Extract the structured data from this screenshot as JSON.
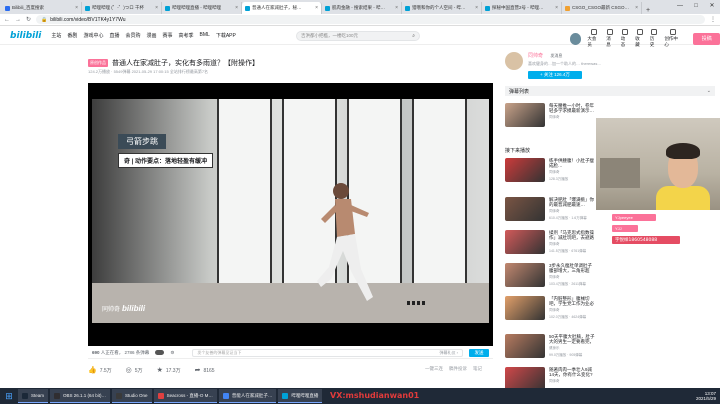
{
  "browser": {
    "tabs": [
      {
        "label": "Bilibili_百度搜索",
        "color": "#2a6cf0",
        "active": false
      },
      {
        "label": "哔哩哔哩 (゜-゜)つロ 干杯",
        "color": "#00a1d6",
        "active": false
      },
      {
        "label": "哔哩哔哩直播 - 哔哩哔哩",
        "color": "#00a1d6",
        "active": false
      },
      {
        "label": "普通人在家减肚子，秘…",
        "color": "#00a1d6",
        "active": true
      },
      {
        "label": "肌肉金融 - 搜索结果 - 哔…",
        "color": "#00a1d6",
        "active": false
      },
      {
        "label": "猎哦和你的个人空间 - 哔…",
        "color": "#00a1d6",
        "active": false
      },
      {
        "label": "探秘中国直营2号 - 哔哩…",
        "color": "#00a1d6",
        "active": false
      },
      {
        "label": "CSGO_CSGO最新 CSGO…",
        "color": "#f0a030",
        "active": false
      }
    ],
    "url": "bilibili.com/video/BV1TK4y1Y7Wu",
    "window_controls": [
      "—",
      "□",
      "✕"
    ]
  },
  "header": {
    "logo": "bilibili",
    "nav": [
      "主站",
      "番剧",
      "游戏中心",
      "直播",
      "会员购",
      "漫画",
      "赛事",
      "高考季",
      "BML",
      "下载APP"
    ],
    "search_placeholder": "吉洪都小把槛，一楼吃100元",
    "right_items": [
      "大会员",
      "消息",
      "动态",
      "收藏",
      "历史",
      "创作中心"
    ],
    "upload_label": "投稿"
  },
  "video": {
    "badge": "原创作品",
    "title": "普通人在家减肚子，实化有多雨道？【附操作】",
    "meta": "124.2万播放 · 5549弹幕    2021-05-29 17:00:15  全站排行榜最高第7名",
    "caption_main": "弓箭步跳",
    "caption_sub": "奇 | 动作要点：落地轻盈有缓冲",
    "watermark_name": "同帅奇",
    "watermark_logo": "bilibili",
    "danmaku_stats_count": "690",
    "danmaku_stats_text": "人正在看，",
    "danmaku_stats_dm": "2786 条弹幕",
    "danmaku_input_placeholder": "发个友善的弹幕见证当下",
    "danmaku_etiquette": "弹幕礼仪 ›",
    "danmaku_send": "发送",
    "actions": [
      {
        "icon": "like-icon",
        "glyph": "👍",
        "label": "7.5万"
      },
      {
        "icon": "coin-icon",
        "glyph": "◎",
        "label": "5万"
      },
      {
        "icon": "star-icon",
        "glyph": "★",
        "label": "17.3万"
      },
      {
        "icon": "share-icon",
        "glyph": "➦",
        "label": "8165"
      }
    ],
    "right_actions": [
      "一键三连",
      "稿件投诉",
      "笔记"
    ]
  },
  "uploader": {
    "name": "同帅奇",
    "message_label": "发消息",
    "desc": "喜欢健身的…加一个助人的… therewas…",
    "follow_label": "+ 关注 126.4万"
  },
  "sidebar": {
    "danmaku_list_label": "弹幕列表",
    "next_label": "接下来播放",
    "autoplay_label": "自动连播",
    "recommendations": [
      {
        "title": "每天腰推一小时，卷年轻多学求摸最新演示…",
        "author": "同帅奇",
        "stats": "",
        "color": "#c9a38a"
      },
      {
        "title": "练手供腰腹！小肚子瘦成脸…",
        "author": "同帅奇",
        "stats": "128.3万播放",
        "color": "#cc3b3b"
      },
      {
        "title": "解决肥肚「爆满挑」你的最晋减肥最速…",
        "author": "同帅奇",
        "stats": "610.4万播放 · 1.6万弹幕",
        "color": "#7a5544"
      },
      {
        "title": "揉剂「马克思式指数操作」减肚玩吧，去避路达关，让诺…",
        "author": "同帅奇",
        "stats": "141.5万播放 · 6761弹幕",
        "color": "#d25a5a"
      },
      {
        "title": "3步永久瘦肚单调肚子腹部增大，三角形超绝！",
        "author": "同帅奇",
        "stats": "103.4万播放 · 2611弹幕",
        "color": "#c28870"
      },
      {
        "title": "「内脏整形」腹械切吧，学生党工作为业必备 快速…",
        "author": "同帅奇",
        "stats": "102.0万播放 · 4624弹幕",
        "color": "#e2a06a"
      },
      {
        "title": "50天平腹大肚腩，肚子大的男生一定要看完，带着…",
        "author": "健身乐",
        "stats": "99.0万播放 · 905弹幕",
        "color": "#b77b60"
      },
      {
        "title": "随著肉肉一季壮人9减14天，你有什么变化?",
        "author": "同帅奇",
        "stats": "",
        "color": "#d1484a"
      }
    ]
  },
  "overlay": {
    "tag1": "YJpeeyee",
    "tag2": "YJJ",
    "tag3": "字悦样1860548088",
    "taskbar_overlay": "VX:mshudianwan01"
  },
  "taskbar": {
    "items": [
      {
        "label": "Steam",
        "color": "#1b2838"
      },
      {
        "label": "OBS 26.1.1 (64 bit)…",
        "color": "#302e31"
      },
      {
        "label": "Studio One",
        "color": "#3a3a3a"
      },
      {
        "label": "Seacross - 直播-O M…",
        "color": "#e04040"
      },
      {
        "label": "普能人在家减肚子…",
        "color": "#4285f4"
      },
      {
        "label": "哔哩哔哩直播",
        "color": "#00a1d6"
      }
    ],
    "time": "13:07",
    "date": "2021/5/29"
  },
  "colors": {
    "brand": "#00a1d6",
    "pink": "#fb7299",
    "accent_blue": "#00aeec"
  }
}
